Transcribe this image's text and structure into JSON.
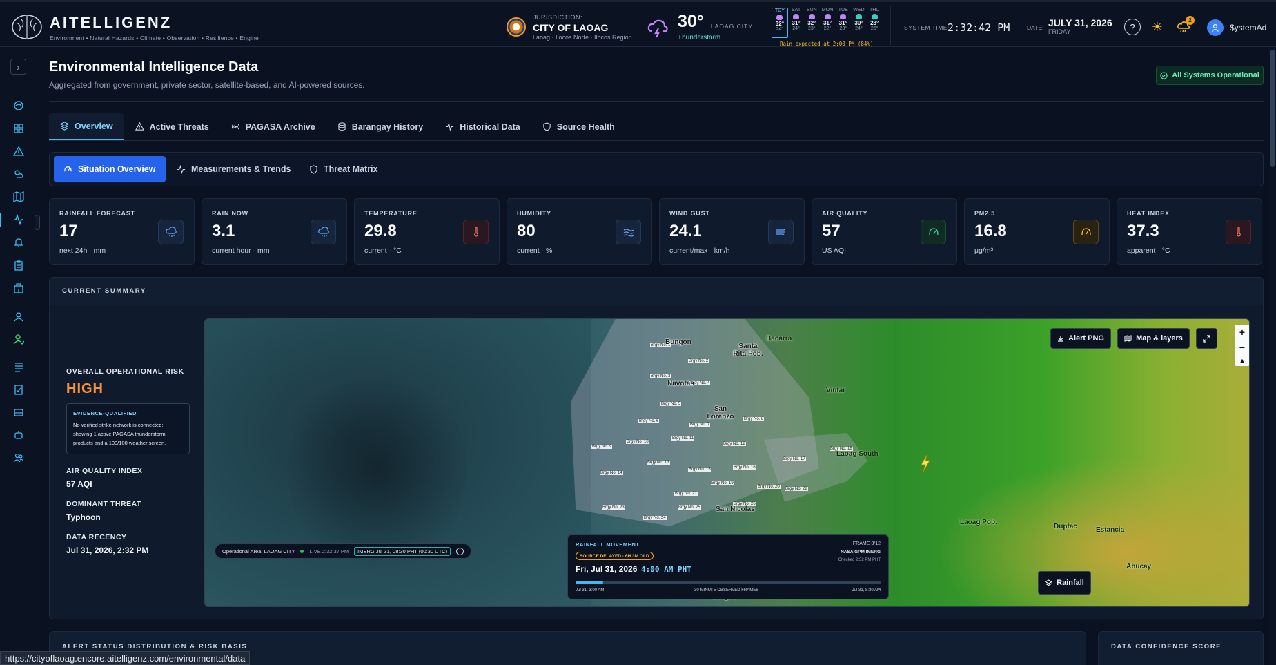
{
  "brand": {
    "name": "AITELLIGENZ",
    "tagline": "Environment • Natural Hazards • Climate • Observation • Resilience • Engine",
    "logo_icon": "brain-icon"
  },
  "header": {
    "jurisdiction_label": "JURISDICTION:",
    "jurisdiction_name": "CITY OF LAOAG",
    "jurisdiction_sub": "Laoag · Ilocos Norte · Ilocos Region",
    "weather": {
      "temp": "30°",
      "city": "LAOAG CITY",
      "condition": "Thunderstorm",
      "icon": "thunderstorm-icon"
    },
    "forecast": [
      {
        "day": "TDY",
        "hi": "32°",
        "lo": "24°"
      },
      {
        "day": "SAT",
        "hi": "31°",
        "lo": "24°"
      },
      {
        "day": "SUN",
        "hi": "32°",
        "lo": "23°"
      },
      {
        "day": "MON",
        "hi": "31°",
        "lo": "22°"
      },
      {
        "day": "TUE",
        "hi": "31°",
        "lo": "23°"
      },
      {
        "day": "WED",
        "hi": "30°",
        "lo": "24°"
      },
      {
        "day": "THU",
        "hi": "28°",
        "lo": "25°"
      }
    ],
    "forecast_note": "Rain expected at 2:00 PM (84%)",
    "system_time_label": "SYSTEM TIME:",
    "system_time": "2:32:42 PM",
    "date_label": "DATE:",
    "date": "JULY 31, 2026",
    "day": "FRIDAY",
    "help_icon": "help-icon",
    "theme_icon": "sun-icon",
    "notif_icon": "weather-alert-icon",
    "notif_count": "2",
    "user": "$ystemAd"
  },
  "sidebar": {
    "toggle": "›",
    "items": [
      "environment-icon",
      "dashboard-icon",
      "warning-icon",
      "weather-icon",
      "map-icon",
      "activity-icon",
      "bell-icon",
      "clipboard-icon",
      "building-icon",
      "contact-icon",
      "user-check-icon",
      "list-icon",
      "report-icon",
      "storage-icon",
      "robot-icon",
      "users-icon"
    ]
  },
  "page": {
    "title": "Environmental Intelligence Data",
    "subtitle": "Aggregated from government, private sector, satellite-based, and AI-powered sources.",
    "status": "All Systems Operational"
  },
  "tabs": [
    {
      "label": "Overview",
      "icon": "layers-icon"
    },
    {
      "label": "Active Threats",
      "icon": "warning-icon"
    },
    {
      "label": "PAGASA Archive",
      "icon": "radio-icon"
    },
    {
      "label": "Barangay History",
      "icon": "database-icon"
    },
    {
      "label": "Historical Data",
      "icon": "activity-icon"
    },
    {
      "label": "Source Health",
      "icon": "shield-icon"
    }
  ],
  "subtabs": [
    {
      "label": "Situation Overview",
      "icon": "gauge-icon"
    },
    {
      "label": "Measurements & Trends",
      "icon": "activity-icon"
    },
    {
      "label": "Threat Matrix",
      "icon": "shield-icon"
    }
  ],
  "kpis": [
    {
      "label": "RAINFALL FORECAST",
      "value": "17",
      "unit": "next 24h · mm",
      "icon": "rain-cloud-icon",
      "color": "#60a5fa"
    },
    {
      "label": "RAIN NOW",
      "value": "3.1",
      "unit": "current hour · mm",
      "icon": "rain-cloud-icon",
      "color": "#60a5fa"
    },
    {
      "label": "TEMPERATURE",
      "value": "29.8",
      "unit": "current · °C",
      "icon": "thermometer-icon",
      "color": "#f87171"
    },
    {
      "label": "HUMIDITY",
      "value": "80",
      "unit": "current · %",
      "icon": "waves-icon",
      "color": "#60a5fa"
    },
    {
      "label": "WIND GUST",
      "value": "24.1",
      "unit": "current/max · km/h",
      "icon": "wind-icon",
      "color": "#60a5fa"
    },
    {
      "label": "AIR QUALITY",
      "value": "57",
      "unit": "US AQI",
      "icon": "gauge-icon",
      "color": "#34d399"
    },
    {
      "label": "PM2.5",
      "value": "16.8",
      "unit": "μg/m³",
      "icon": "gauge-icon",
      "color": "#fbbf24"
    },
    {
      "label": "HEAT INDEX",
      "value": "37.3",
      "unit": "apparent · °C",
      "icon": "thermometer-icon",
      "color": "#f87171"
    }
  ],
  "summary": {
    "title": "CURRENT SUMMARY",
    "risk_label": "OVERALL OPERATIONAL RISK",
    "risk_value": "HIGH",
    "evidence_title": "EVIDENCE-QUALIFIED",
    "evidence_text": "No verified strike network is connected; showing 1 active PAGASA thunderstorm products and a 100/100 weather screen.",
    "aqi_label": "AIR QUALITY INDEX",
    "aqi_value": "57 AQI",
    "threat_label": "DOMINANT THREAT",
    "threat_value": "Typhoon",
    "recency_label": "DATA RECENCY",
    "recency_value": "Jul 31, 2026, 2:32 PM"
  },
  "map": {
    "alert_png": "Alert PNG",
    "layers": "Map & layers",
    "expand_icon": "expand-icon",
    "zoom_in": "+",
    "zoom_out": "−",
    "compass": "▲",
    "places": [
      "Bacarra",
      "Santa Rita Pob.",
      "Vintar",
      "San Lorenzo",
      "San Nicolas",
      "Laoag South",
      "Laoag Pob.",
      "Duptac",
      "Estancia",
      "Abucay",
      "Burgos",
      "Navotas",
      "Bungon"
    ],
    "ops_area": "Operational Area: LAOAG CITY",
    "live": "LIVE 2:32:37 PM",
    "imerg": "IMERG Jul 31, 08:30 PHT (00:30 UTC)",
    "rain_panel": {
      "title": "RAINFALL MOVEMENT",
      "frame": "FRAME 3/12",
      "source": "NASA GPM IMERG",
      "checked": "Checked 2:32 PM PHT",
      "badge": "SOURCE DELAYED · 6H 3M OLD",
      "date": "Fri, Jul 31, 2026",
      "time": "4:00 AM PHT",
      "progress": 0.09,
      "start": "Jul 31, 3:00 AM",
      "mid": "30-MINUTE OBSERVED FRAMES",
      "end": "Jul 31, 8:30 AM"
    },
    "rainfall_btn": "Rainfall"
  },
  "bottom": {
    "left_title": "ALERT STATUS DISTRIBUTION & RISK BASIS",
    "right_title": "DATA CONFIDENCE SCORE"
  },
  "status_url": "https://cityoflaoag.encore.aitelligenz.com/environmental/data"
}
